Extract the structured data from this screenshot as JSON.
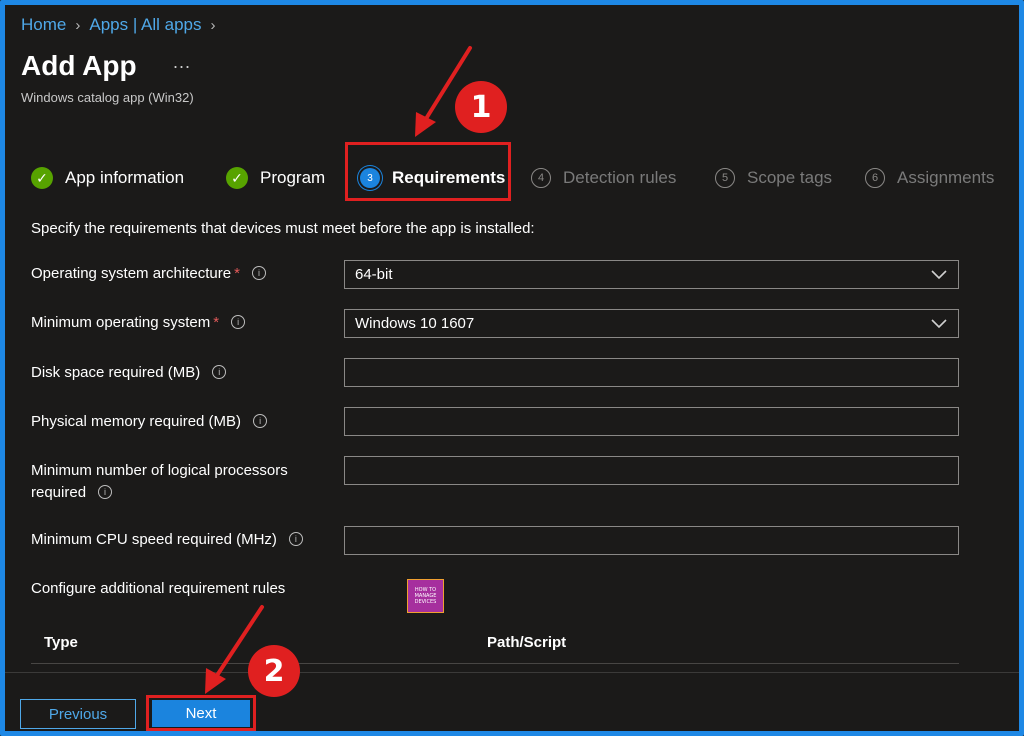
{
  "breadcrumb": [
    "Home",
    "Apps | All apps"
  ],
  "page": {
    "title": "Add App",
    "more": "...",
    "subtitle": "Windows catalog app (Win32)"
  },
  "steps": [
    {
      "label": "App information",
      "state": "done"
    },
    {
      "label": "Program",
      "state": "done"
    },
    {
      "label": "Requirements",
      "number": "3",
      "state": "active"
    },
    {
      "label": "Detection rules",
      "number": "4",
      "state": "future"
    },
    {
      "label": "Scope tags",
      "number": "5",
      "state": "future"
    },
    {
      "label": "Assignments",
      "number": "6",
      "state": "future"
    }
  ],
  "form": {
    "intro": "Specify the requirements that devices must meet before the app is installed:",
    "os_arch": {
      "label": "Operating system architecture",
      "value": "64-bit"
    },
    "min_os": {
      "label": "Minimum operating system",
      "value": "Windows 10 1607"
    },
    "disk_space": {
      "label": "Disk space required (MB)",
      "value": ""
    },
    "physical_memory": {
      "label": "Physical memory required (MB)",
      "value": ""
    },
    "logical_processors": {
      "label_line1": "Minimum number of logical processors",
      "label_line2": "required",
      "value": ""
    },
    "cpu_speed": {
      "label": "Minimum CPU speed required (MHz)",
      "value": ""
    },
    "additional_rules": "Configure additional requirement rules"
  },
  "table": {
    "columns": [
      "Type",
      "Path/Script"
    ]
  },
  "footer": {
    "previous": "Previous",
    "next": "Next"
  },
  "annotations": {
    "badge_1": "1",
    "badge_2": "2",
    "color": "#e02020"
  },
  "watermark": {
    "line1": "HOW TO",
    "line2": "MANAGE",
    "line3": "DEVICES"
  },
  "colors": {
    "accent": "#1b84de",
    "link": "#4fa8e8",
    "success": "#57a300",
    "required": "#e35a5a",
    "frame": "#1e88e5"
  },
  "icons": {
    "step_done": "check-circle-icon",
    "info": "info-icon",
    "dropdown": "chevron-down-icon",
    "more": "more-horizontal-icon"
  }
}
